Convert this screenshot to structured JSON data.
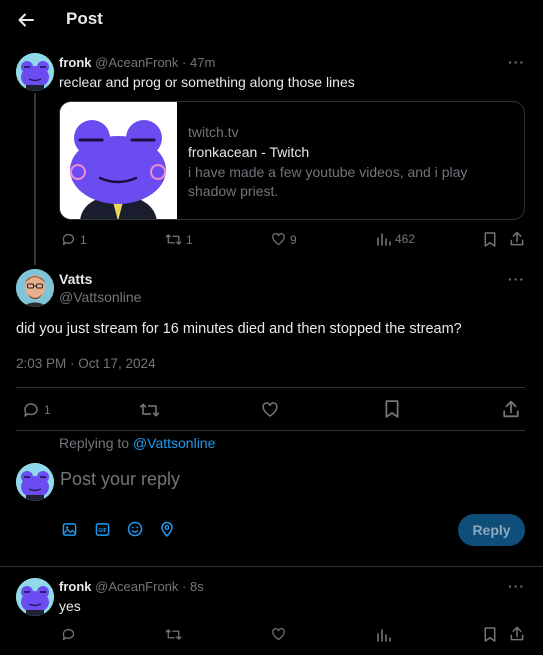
{
  "header": {
    "title": "Post"
  },
  "tweet1": {
    "name": "fronk",
    "handle": "@AceanFronk",
    "time": "· 47m",
    "text": "reclear and prog or something along those lines",
    "card": {
      "domain": "twitch.tv",
      "title": "fronkacean - Twitch",
      "description": "i have made a few youtube videos, and i play shadow priest."
    },
    "actions": {
      "replies": "1",
      "reposts": "1",
      "likes": "9",
      "views": "462"
    }
  },
  "main_post": {
    "name": "Vatts",
    "handle": "@Vattsonline",
    "text": "did you just stream for 16 minutes died and then stopped the stream?",
    "timestamp": "2:03 PM · Oct 17, 2024",
    "actions": {
      "replies": "1"
    }
  },
  "reply_box": {
    "replying_prefix": "Replying to",
    "replying_handle": "@Vattsonline",
    "placeholder": "Post your reply",
    "button": "Reply"
  },
  "tweet3": {
    "name": "fronk",
    "handle": "@AceanFronk",
    "time": "· 8s",
    "text": "yes"
  },
  "colors": {
    "accent": "#1d9bf0",
    "muted": "#71767b",
    "border": "#2f3336",
    "frog": "#6a4cf0"
  }
}
